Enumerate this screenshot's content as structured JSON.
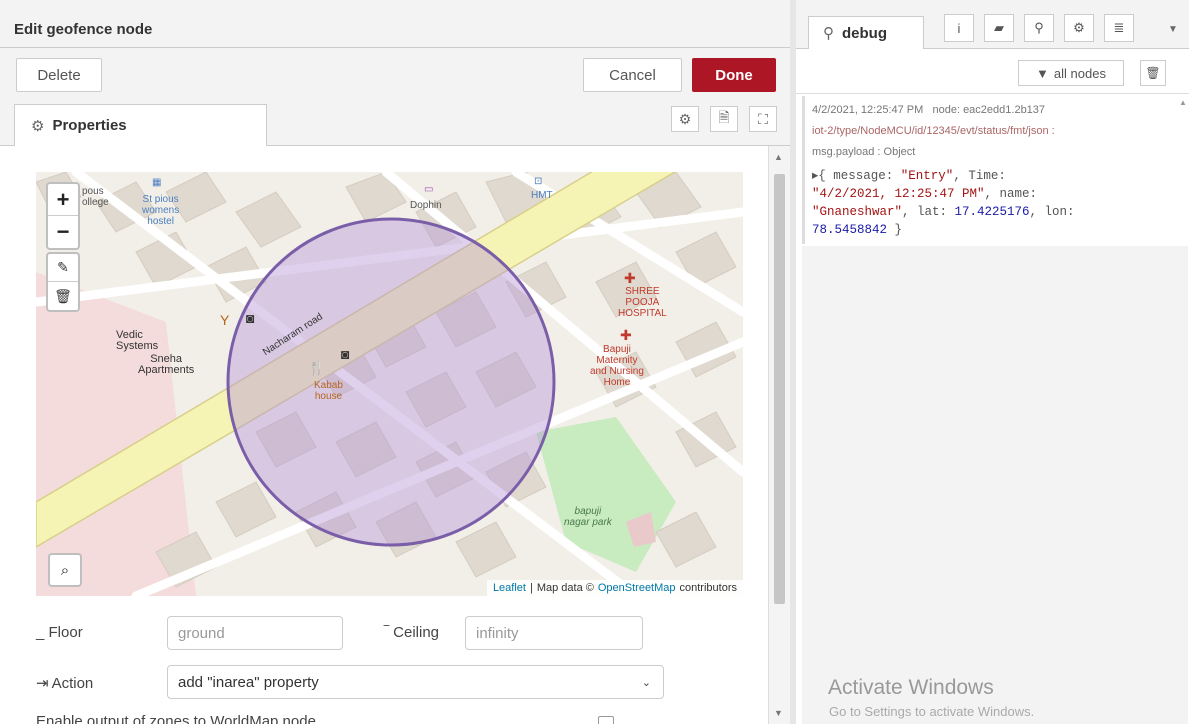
{
  "tray": {
    "title": "Edit geofence node",
    "delete_label": "Delete",
    "cancel_label": "Cancel",
    "done_label": "Done",
    "properties_tab": "Properties",
    "tab_icons": [
      "gear-icon",
      "document-icon",
      "frame-icon"
    ]
  },
  "map": {
    "labels": {
      "college": "pous\nollege",
      "hostel": "St pious\nwomens\nhostel",
      "dophin": "Dophin",
      "hmt": "HMT",
      "hospital": "SHREE\nPOOJA\nHOSPITAL",
      "maternity": "Bapuji\nMaternity\nand Nursing\nHome",
      "vedic": "Vedic\nSystems",
      "sneha": "Sneha\nApartments",
      "kabab": "Kabab\nhouse",
      "park": "bapuji\nnagar park",
      "road": "Nacharam road"
    },
    "attribution": {
      "leaflet": "Leaflet",
      "sep": "|",
      "text": "Map data ©",
      "osm": "OpenStreetMap",
      "contributors": "contributors"
    }
  },
  "form": {
    "floor_label": "_ Floor",
    "floor_placeholder": "ground",
    "ceiling_label": "‾ Ceiling",
    "ceiling_placeholder": "infinity",
    "action_label": "Action",
    "action_value": "add \"inarea\" property",
    "enable_label": "Enable output of zones to WorldMap node"
  },
  "sidebar": {
    "debug_tab": "debug",
    "icons": [
      "info-icon",
      "book-icon",
      "bug-icon",
      "gear-icon",
      "database-icon"
    ],
    "all_nodes_label": "all nodes",
    "message": {
      "timestamp": "4/2/2021, 12:25:47 PM",
      "node": "node: eac2edd1.2b137",
      "topic": "iot-2/type/NodeMCU/id/12345/evt/status/fmt/json :",
      "payload_type": "msg.payload : Object",
      "line1_a": "▸{ message: ",
      "line1_b": "\"Entry\"",
      "line1_c": ", Time:",
      "line2_a": "\"4/2/2021, 12:25:47 PM\"",
      "line2_b": ", name:",
      "line3_a": "\"Gnaneshwar\"",
      "line3_b": ", lat: ",
      "line3_c": "17.4225176",
      "line3_d": ", lon:",
      "line4_a": "78.5458842",
      "line4_b": " }"
    }
  },
  "watermark": {
    "title": "Activate Windows",
    "subtitle": "Go to Settings to activate Windows."
  },
  "colors": {
    "done": "#ad1625",
    "geofence_fill": "#b89ad6",
    "geofence_stroke": "#7b5ea8",
    "main_road": "#f6f4b4"
  }
}
